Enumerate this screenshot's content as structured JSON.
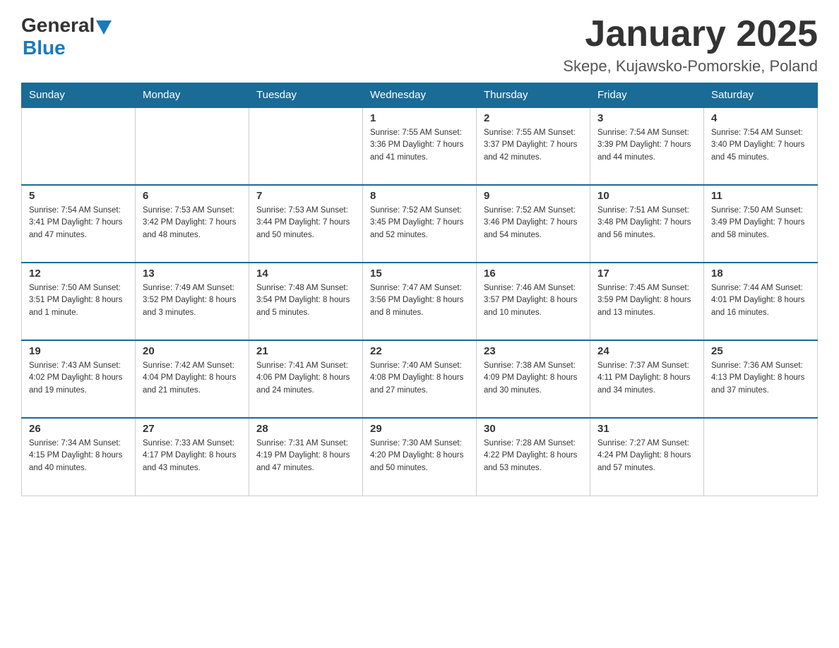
{
  "header": {
    "logo": {
      "general": "General",
      "blue": "Blue"
    },
    "title": "January 2025",
    "subtitle": "Skepe, Kujawsko-Pomorskie, Poland"
  },
  "days_of_week": [
    "Sunday",
    "Monday",
    "Tuesday",
    "Wednesday",
    "Thursday",
    "Friday",
    "Saturday"
  ],
  "weeks": [
    {
      "cells": [
        {
          "day": "",
          "info": ""
        },
        {
          "day": "",
          "info": ""
        },
        {
          "day": "",
          "info": ""
        },
        {
          "day": "1",
          "info": "Sunrise: 7:55 AM\nSunset: 3:36 PM\nDaylight: 7 hours\nand 41 minutes."
        },
        {
          "day": "2",
          "info": "Sunrise: 7:55 AM\nSunset: 3:37 PM\nDaylight: 7 hours\nand 42 minutes."
        },
        {
          "day": "3",
          "info": "Sunrise: 7:54 AM\nSunset: 3:39 PM\nDaylight: 7 hours\nand 44 minutes."
        },
        {
          "day": "4",
          "info": "Sunrise: 7:54 AM\nSunset: 3:40 PM\nDaylight: 7 hours\nand 45 minutes."
        }
      ]
    },
    {
      "cells": [
        {
          "day": "5",
          "info": "Sunrise: 7:54 AM\nSunset: 3:41 PM\nDaylight: 7 hours\nand 47 minutes."
        },
        {
          "day": "6",
          "info": "Sunrise: 7:53 AM\nSunset: 3:42 PM\nDaylight: 7 hours\nand 48 minutes."
        },
        {
          "day": "7",
          "info": "Sunrise: 7:53 AM\nSunset: 3:44 PM\nDaylight: 7 hours\nand 50 minutes."
        },
        {
          "day": "8",
          "info": "Sunrise: 7:52 AM\nSunset: 3:45 PM\nDaylight: 7 hours\nand 52 minutes."
        },
        {
          "day": "9",
          "info": "Sunrise: 7:52 AM\nSunset: 3:46 PM\nDaylight: 7 hours\nand 54 minutes."
        },
        {
          "day": "10",
          "info": "Sunrise: 7:51 AM\nSunset: 3:48 PM\nDaylight: 7 hours\nand 56 minutes."
        },
        {
          "day": "11",
          "info": "Sunrise: 7:50 AM\nSunset: 3:49 PM\nDaylight: 7 hours\nand 58 minutes."
        }
      ]
    },
    {
      "cells": [
        {
          "day": "12",
          "info": "Sunrise: 7:50 AM\nSunset: 3:51 PM\nDaylight: 8 hours\nand 1 minute."
        },
        {
          "day": "13",
          "info": "Sunrise: 7:49 AM\nSunset: 3:52 PM\nDaylight: 8 hours\nand 3 minutes."
        },
        {
          "day": "14",
          "info": "Sunrise: 7:48 AM\nSunset: 3:54 PM\nDaylight: 8 hours\nand 5 minutes."
        },
        {
          "day": "15",
          "info": "Sunrise: 7:47 AM\nSunset: 3:56 PM\nDaylight: 8 hours\nand 8 minutes."
        },
        {
          "day": "16",
          "info": "Sunrise: 7:46 AM\nSunset: 3:57 PM\nDaylight: 8 hours\nand 10 minutes."
        },
        {
          "day": "17",
          "info": "Sunrise: 7:45 AM\nSunset: 3:59 PM\nDaylight: 8 hours\nand 13 minutes."
        },
        {
          "day": "18",
          "info": "Sunrise: 7:44 AM\nSunset: 4:01 PM\nDaylight: 8 hours\nand 16 minutes."
        }
      ]
    },
    {
      "cells": [
        {
          "day": "19",
          "info": "Sunrise: 7:43 AM\nSunset: 4:02 PM\nDaylight: 8 hours\nand 19 minutes."
        },
        {
          "day": "20",
          "info": "Sunrise: 7:42 AM\nSunset: 4:04 PM\nDaylight: 8 hours\nand 21 minutes."
        },
        {
          "day": "21",
          "info": "Sunrise: 7:41 AM\nSunset: 4:06 PM\nDaylight: 8 hours\nand 24 minutes."
        },
        {
          "day": "22",
          "info": "Sunrise: 7:40 AM\nSunset: 4:08 PM\nDaylight: 8 hours\nand 27 minutes."
        },
        {
          "day": "23",
          "info": "Sunrise: 7:38 AM\nSunset: 4:09 PM\nDaylight: 8 hours\nand 30 minutes."
        },
        {
          "day": "24",
          "info": "Sunrise: 7:37 AM\nSunset: 4:11 PM\nDaylight: 8 hours\nand 34 minutes."
        },
        {
          "day": "25",
          "info": "Sunrise: 7:36 AM\nSunset: 4:13 PM\nDaylight: 8 hours\nand 37 minutes."
        }
      ]
    },
    {
      "cells": [
        {
          "day": "26",
          "info": "Sunrise: 7:34 AM\nSunset: 4:15 PM\nDaylight: 8 hours\nand 40 minutes."
        },
        {
          "day": "27",
          "info": "Sunrise: 7:33 AM\nSunset: 4:17 PM\nDaylight: 8 hours\nand 43 minutes."
        },
        {
          "day": "28",
          "info": "Sunrise: 7:31 AM\nSunset: 4:19 PM\nDaylight: 8 hours\nand 47 minutes."
        },
        {
          "day": "29",
          "info": "Sunrise: 7:30 AM\nSunset: 4:20 PM\nDaylight: 8 hours\nand 50 minutes."
        },
        {
          "day": "30",
          "info": "Sunrise: 7:28 AM\nSunset: 4:22 PM\nDaylight: 8 hours\nand 53 minutes."
        },
        {
          "day": "31",
          "info": "Sunrise: 7:27 AM\nSunset: 4:24 PM\nDaylight: 8 hours\nand 57 minutes."
        },
        {
          "day": "",
          "info": ""
        }
      ]
    }
  ]
}
